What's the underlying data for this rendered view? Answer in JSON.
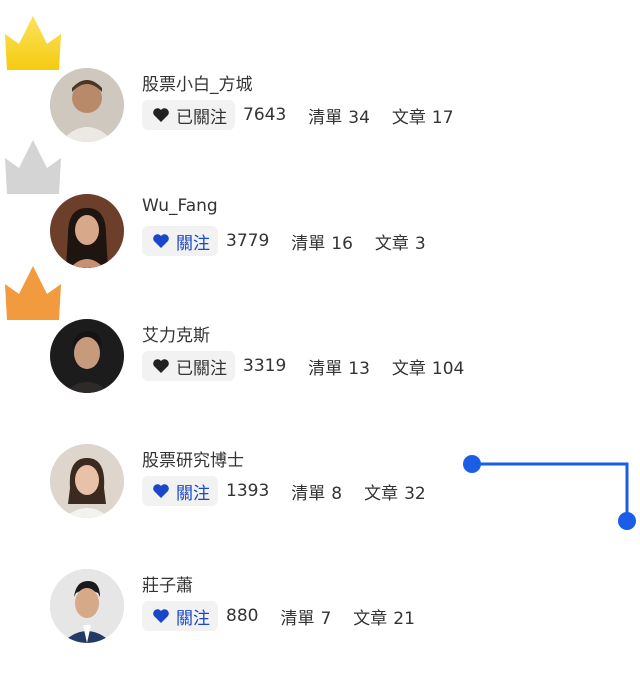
{
  "users": [
    {
      "name": "股票小白_方城",
      "follow_label": "已關注",
      "following": true,
      "followers": "7643",
      "lists_label": "清單",
      "lists": "34",
      "articles_label": "文章",
      "articles": "17",
      "crown": "gold"
    },
    {
      "name": "Wu_Fang",
      "follow_label": "關注",
      "following": false,
      "followers": "3779",
      "lists_label": "清單",
      "lists": "16",
      "articles_label": "文章",
      "articles": "3",
      "crown": "silver"
    },
    {
      "name": "艾力克斯",
      "follow_label": "已關注",
      "following": true,
      "followers": "3319",
      "lists_label": "清單",
      "lists": "13",
      "articles_label": "文章",
      "articles": "104",
      "crown": "bronze"
    },
    {
      "name": "股票研究博士",
      "follow_label": "關注",
      "following": false,
      "followers": "1393",
      "lists_label": "清單",
      "lists": "8",
      "articles_label": "文章",
      "articles": "32",
      "crown": null
    },
    {
      "name": "莊子蕭",
      "follow_label": "關注",
      "following": false,
      "followers": "880",
      "lists_label": "清單",
      "lists": "7",
      "articles_label": "文章",
      "articles": "21",
      "crown": null
    }
  ],
  "colors": {
    "gold": "#f7d21f",
    "silver": "#d4d4d4",
    "bronze": "#f29a3e",
    "follow_blue": "#1a46c9",
    "connector_blue": "#1a5ee6"
  },
  "icons": {
    "crown": "crown-icon",
    "heart": "heart-icon"
  }
}
